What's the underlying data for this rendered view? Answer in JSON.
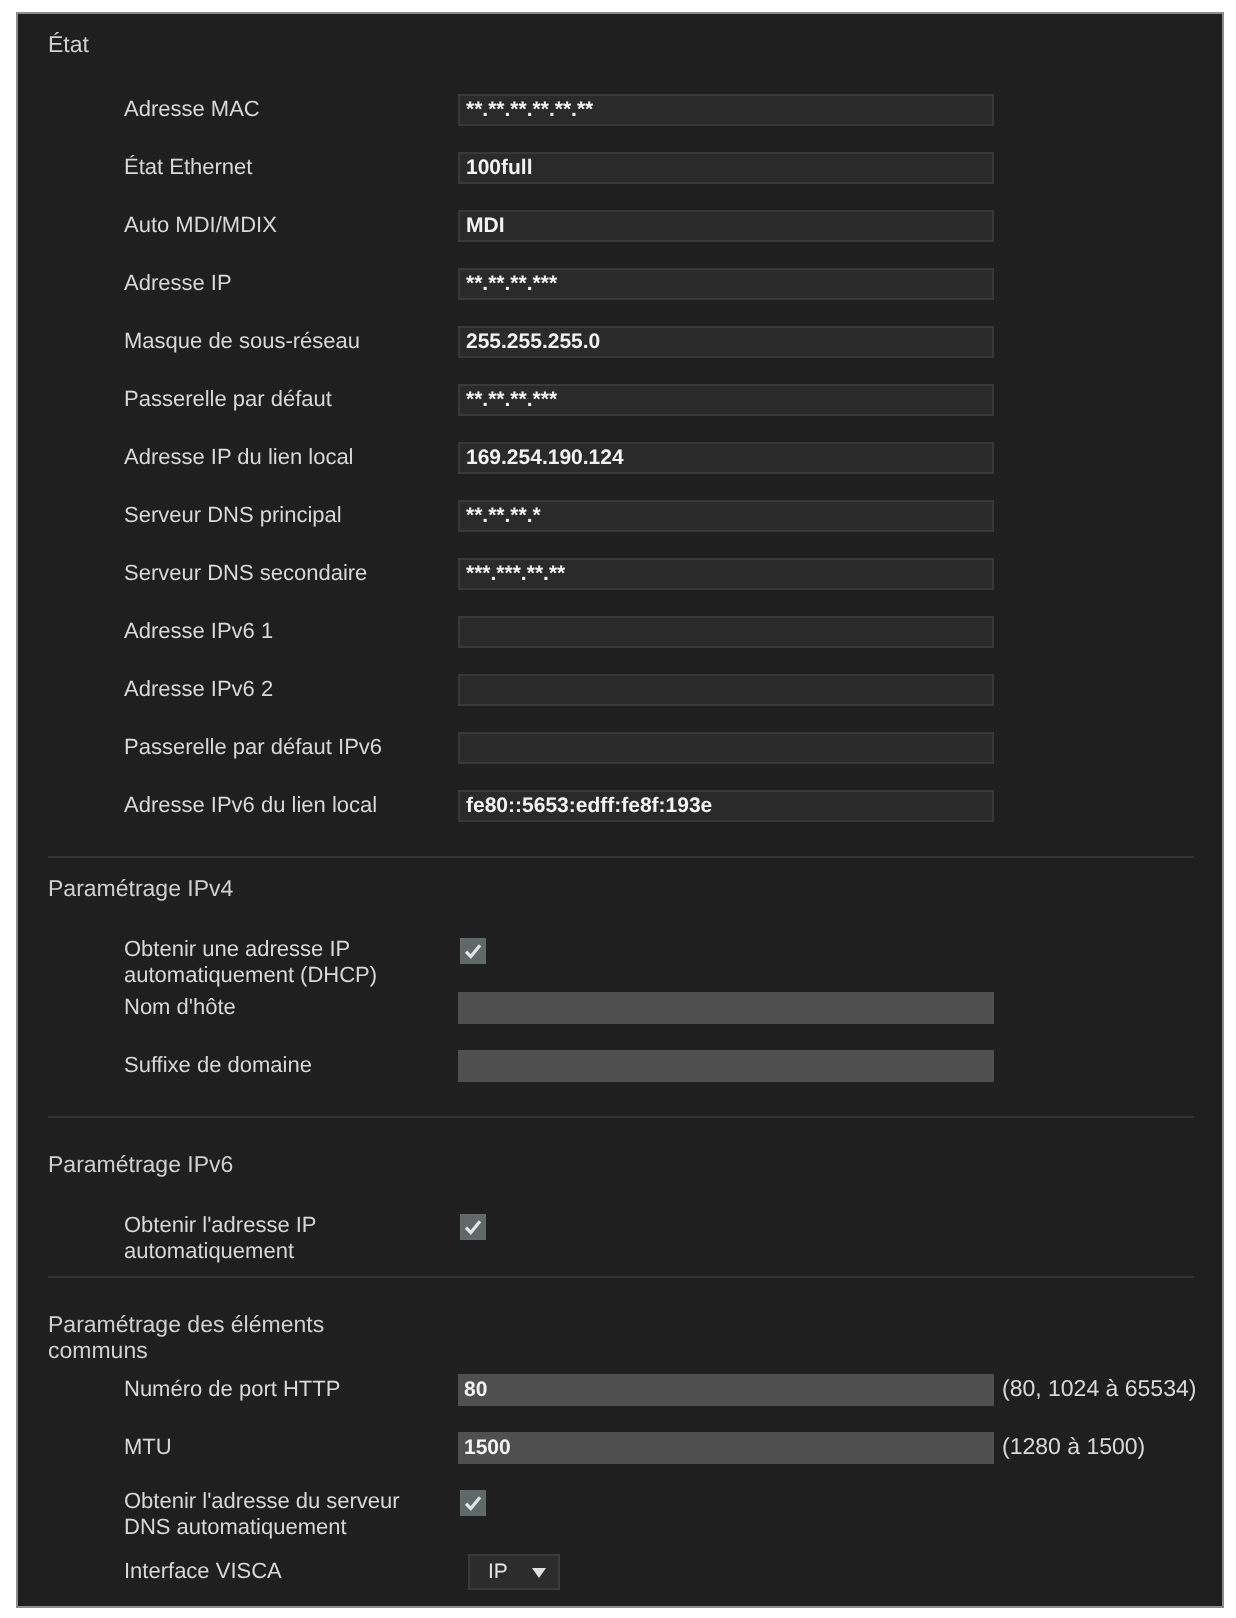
{
  "sections": [
    {
      "title": "État",
      "rows": [
        {
          "kind": "field",
          "label": "Adresse MAC",
          "value": "**.**.**.**.**.**",
          "readonly": true
        },
        {
          "kind": "field",
          "label": "État Ethernet",
          "value": "100full",
          "readonly": true
        },
        {
          "kind": "field",
          "label": "Auto MDI/MDIX",
          "value": "MDI",
          "readonly": true
        },
        {
          "kind": "field",
          "label": "Adresse IP",
          "value": "**.**.**.***",
          "readonly": true
        },
        {
          "kind": "field",
          "label": "Masque de sous-réseau",
          "value": "255.255.255.0",
          "readonly": true
        },
        {
          "kind": "field",
          "label": "Passerelle par défaut",
          "value": "**.**.**.***",
          "readonly": true
        },
        {
          "kind": "field",
          "label": "Adresse IP du lien local",
          "value": "169.254.190.124",
          "readonly": true
        },
        {
          "kind": "field",
          "label": "Serveur DNS principal",
          "value": "**.**.**.*",
          "readonly": true
        },
        {
          "kind": "field",
          "label": "Serveur DNS secondaire",
          "value": "***.***.**.**",
          "readonly": true
        },
        {
          "kind": "field",
          "label": "Adresse IPv6 1",
          "readonly": true
        },
        {
          "kind": "field",
          "label": "Adresse IPv6 2",
          "readonly": true
        },
        {
          "kind": "field",
          "label": "Passerelle par défaut IPv6",
          "readonly": true
        },
        {
          "kind": "field",
          "label": "Adresse IPv6 du lien local",
          "value": "fe80::5653:edff:fe8f:193e",
          "readonly": true
        }
      ]
    },
    {
      "title": "Paramétrage IPv4",
      "rows": [
        {
          "kind": "checkbox",
          "label": "Obtenir une adresse IP automatiquement (DHCP)",
          "checked": true
        },
        {
          "kind": "field",
          "label": "Nom d'hôte",
          "readonly": false
        },
        {
          "kind": "field",
          "label": "Suffixe de domaine",
          "readonly": false
        }
      ]
    },
    {
      "title": "Paramétrage IPv6",
      "rows": [
        {
          "kind": "checkbox",
          "label": "Obtenir l'adresse IP automatiquement",
          "checked": true
        }
      ]
    },
    {
      "title": "Paramétrage des éléments communs",
      "rows": [
        {
          "kind": "field",
          "label": "Numéro de port HTTP",
          "value": "80",
          "readonly": false,
          "hint": "(80, 1024 à 65534)"
        },
        {
          "kind": "field",
          "label": "MTU",
          "value": "1500",
          "readonly": false,
          "hint": "(1280 à 1500)"
        },
        {
          "kind": "checkbox",
          "label": "Obtenir l'adresse du serveur DNS automatiquement",
          "checked": true
        },
        {
          "kind": "select",
          "label": "Interface VISCA",
          "value": "IP"
        }
      ]
    }
  ]
}
